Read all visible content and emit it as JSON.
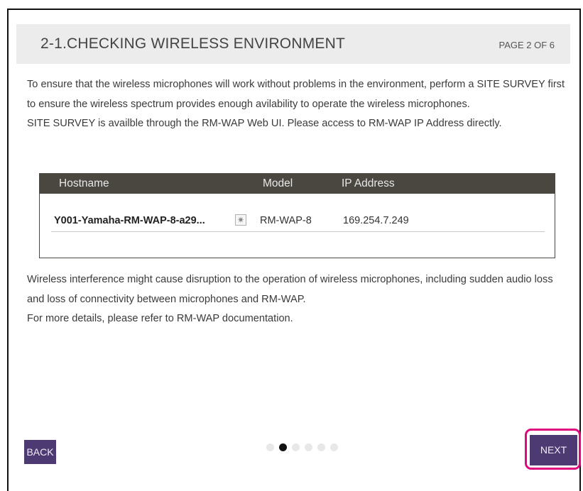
{
  "header": {
    "title": "2-1.CHECKING WIRELESS ENVIRONMENT",
    "page": "PAGE 2 OF 6"
  },
  "intro": {
    "line1": "To ensure that the wireless microphones will work without problems in the environment, perform a SITE SURVEY first to ensure the wireless spectrum provides enough avilability to operate the wireless microphones.",
    "line2": "SITE SURVEY is availble through the RM-WAP Web UI. Please access to RM-WAP IP Address directly."
  },
  "table": {
    "columns": {
      "hostname": "Hostname",
      "model": "Model",
      "ip": "IP Address"
    },
    "rows": [
      {
        "hostname": "Y001-Yamaha-RM-WAP-8-a29...",
        "icon": "identify-icon",
        "model": "RM-WAP-8",
        "ip": "169.254.7.249"
      }
    ]
  },
  "warning": {
    "line1": "Wireless interference might cause disruption to the operation of wireless microphones, including sudden audio loss and loss of connectivity between microphones and RM-WAP.",
    "line2": "For more details, please refer to RM-WAP documentation."
  },
  "pagination": {
    "total": 6,
    "current": 2
  },
  "buttons": {
    "back": "BACK",
    "next": "NEXT"
  },
  "colors": {
    "accent": "#4d3a73",
    "highlight": "#e0087e",
    "table_header": "#4a4741",
    "header_bg": "#ececec"
  }
}
